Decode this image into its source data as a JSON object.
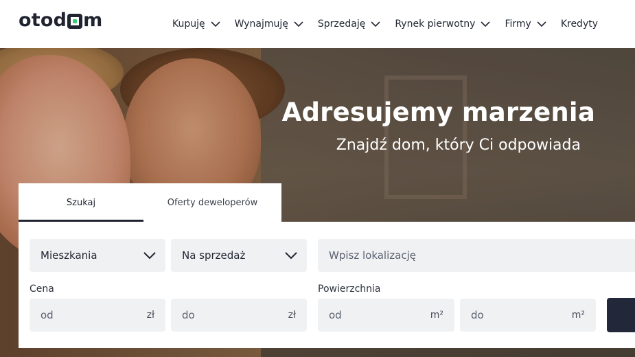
{
  "brand": {
    "name": "otodom",
    "accent": "#3ccd7a"
  },
  "nav": {
    "items": [
      {
        "label": "Kupuję",
        "has_menu": true
      },
      {
        "label": "Wynajmuję",
        "has_menu": true
      },
      {
        "label": "Sprzedaję",
        "has_menu": true
      },
      {
        "label": "Rynek pierwotny",
        "has_menu": true
      },
      {
        "label": "Firmy",
        "has_menu": true
      },
      {
        "label": "Kredyty",
        "has_menu": false
      }
    ]
  },
  "hero": {
    "title": "Adresujemy marzenia",
    "subtitle": "Znajdź dom, który Ci odpowiada"
  },
  "search": {
    "tabs": [
      {
        "label": "Szukaj",
        "active": true
      },
      {
        "label": "Oferty deweloperów",
        "active": false
      }
    ],
    "property_type": "Mieszkania",
    "transaction_type": "Na sprzedaż",
    "location_placeholder": "Wpisz lokalizację",
    "price": {
      "label": "Cena",
      "from_placeholder": "od",
      "to_placeholder": "do",
      "unit": "zł"
    },
    "area": {
      "label": "Powierzchnia",
      "from_placeholder": "od",
      "to_placeholder": "do",
      "unit": "m²"
    }
  }
}
